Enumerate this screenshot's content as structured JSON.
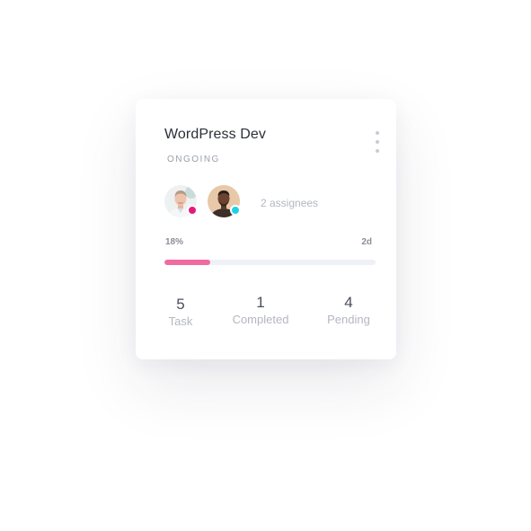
{
  "card": {
    "title": "WordPress Dev",
    "status": "ONGOING",
    "menu_icon": "kebab-menu-icon",
    "assignees": [
      {
        "avatar": "avatar-man-light-hair",
        "status_color": "#e5197a"
      },
      {
        "avatar": "avatar-man-dark-skin",
        "status_color": "#1fd1e6"
      }
    ],
    "assignees_label": "2 assignees",
    "progress": {
      "percent_label": "18%",
      "value": 0.215,
      "remaining_label": "2d",
      "bar_color": "#f06ba0",
      "track_color": "#eef2f7"
    },
    "stats": [
      {
        "value": "5",
        "label": "Task"
      },
      {
        "value": "1",
        "label": "Completed"
      },
      {
        "value": "4",
        "label": "Pending"
      }
    ]
  }
}
